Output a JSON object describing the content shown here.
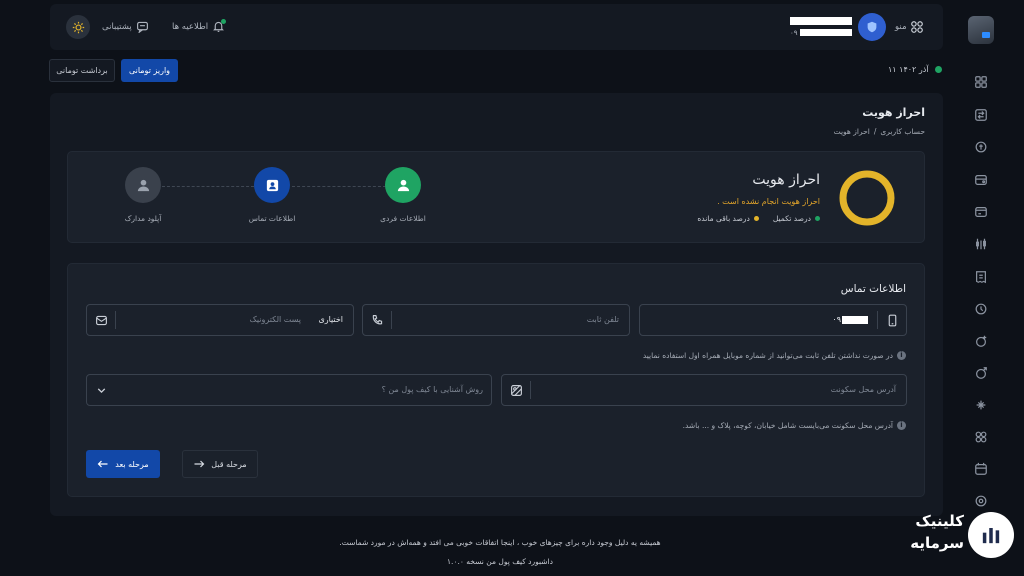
{
  "header": {
    "menu_label": "منو",
    "phone_masked": "۰۹",
    "notifications_label": "اطلاعیه ها",
    "support_label": "پشتیبانی"
  },
  "date_label": "۱۱ آذر ۱۴۰۲",
  "buttons": {
    "deposit": "واریز تومانی",
    "withdraw": "برداشت تومانی",
    "next": "مرحله بعد",
    "prev": "مرحله قبل"
  },
  "page": {
    "title": "احراز هویت",
    "breadcrumb": [
      "حساب کاربری",
      "احراز هویت"
    ],
    "breadcrumb_sep": "/"
  },
  "status": {
    "title": "احراز هویت",
    "message": "احراز هویت انجام نشده است .",
    "legend_complete": "درصد تکمیل",
    "legend_remaining": "درصد باقی مانده",
    "progress_complete": 0
  },
  "steps": [
    {
      "label": "اطلاعات فردی",
      "state": "done",
      "color": "#1fa463"
    },
    {
      "label": "اطلاعات تماس",
      "state": "current",
      "color": "#1248a8"
    },
    {
      "label": "آپلود مدارک",
      "state": "pending",
      "color": "#3a414c"
    }
  ],
  "contact": {
    "title": "اطلاعات تماس",
    "mobile_value": "۰۹",
    "landline_placeholder": "تلفن ثابت",
    "email_placeholder": "پست الکترونیک",
    "email_optional": "اختیاری",
    "landline_note": "در صورت نداشتن تلفن ثابت می‌توانید از شماره موبایل همراه اول استفاده نمایید",
    "address_placeholder": "آدرس محل سکونت",
    "acquaintance_placeholder": "روش آشنایی با کیف پول من ؟",
    "address_note": "آدرس محل سکونت می‌بایست شامل خیابان، کوچه، پلاک و ... باشد."
  },
  "footer": {
    "line1": "همیشه یه دلیل وجود داره برای چیزهای خوب ، اینجا اتفاقات خوبی می افتد و همه‌اش در مورد شماست.",
    "line2": "داشبورد کیف پول من نسخه ۱.۰.۰"
  },
  "watermark": {
    "line1": "کلینیک",
    "line2": "سرمایه"
  },
  "colors": {
    "accent_blue": "#1248a8",
    "progress_yellow": "#e3b42a",
    "status_green": "#1fa463",
    "warning_text": "#e3a52a"
  }
}
